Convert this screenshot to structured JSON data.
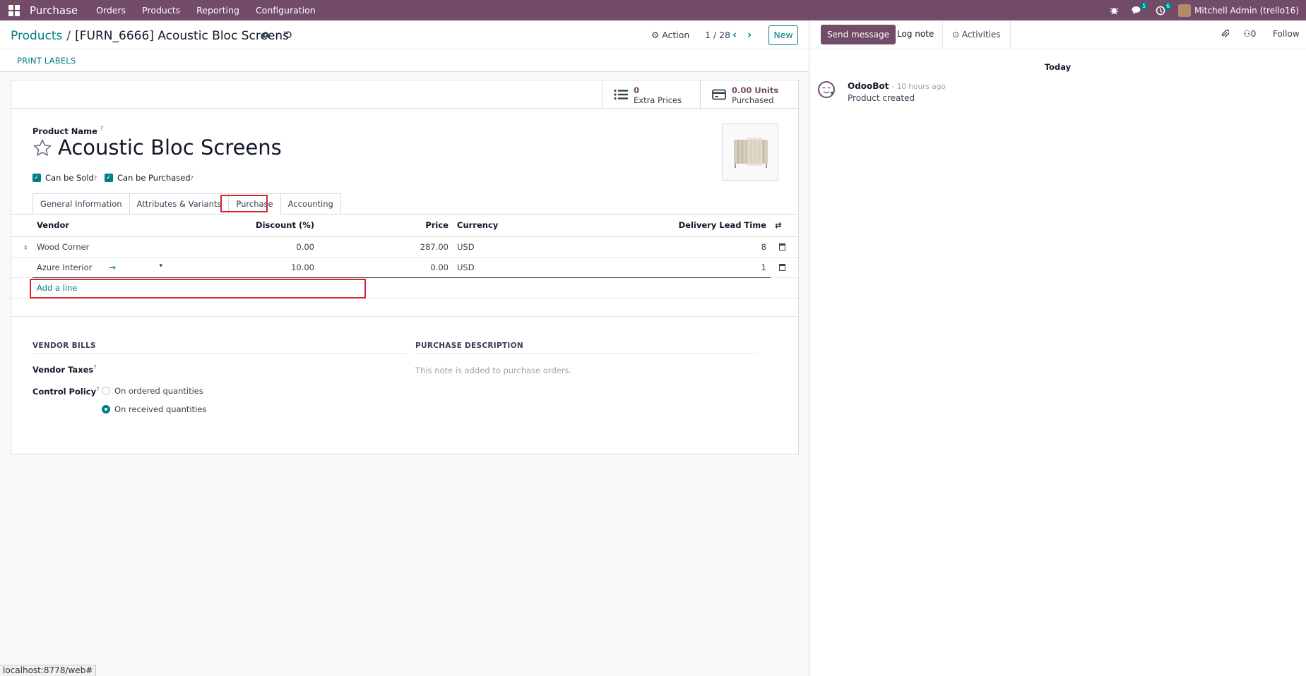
{
  "topbar": {
    "app_name": "Purchase",
    "menu": [
      "Orders",
      "Products",
      "Reporting",
      "Configuration"
    ],
    "messages_count": "5",
    "activities_count": "6",
    "user": "Mitchell Admin (trello16)"
  },
  "breadcrumb": {
    "parent": "Products",
    "separator": "/",
    "current": "[FURN_6666] Acoustic Bloc Screens"
  },
  "control": {
    "action_label": "Action",
    "pager": "1 / 28",
    "new_label": "New"
  },
  "subbar": {
    "print_labels": "PRINT LABELS"
  },
  "stats": {
    "extra_prices_value": "0",
    "extra_prices_label": "Extra Prices",
    "purchased_value": "0.00 Units",
    "purchased_label": "Purchased"
  },
  "product": {
    "name_label": "Product Name",
    "tooltip_mark": "?",
    "name": "Acoustic Bloc Screens",
    "can_be_sold": "Can be Sold",
    "can_be_purchased": "Can be Purchased"
  },
  "tabs": [
    "General Information",
    "Attributes & Variants",
    "Purchase",
    "Accounting"
  ],
  "vendor_table": {
    "headers": [
      "Vendor",
      "Discount (%)",
      "Price",
      "Currency",
      "Delivery Lead Time"
    ],
    "rows": [
      {
        "vendor": "Wood Corner",
        "discount": "0.00",
        "price": "287.00",
        "currency": "USD",
        "lead_time": "8"
      },
      {
        "vendor": "Azure Interior",
        "discount": "10.00",
        "price": "0.00",
        "currency": "USD",
        "lead_time": "1"
      }
    ],
    "add_line": "Add a line"
  },
  "vendor_bills": {
    "title": "VENDOR BILLS",
    "taxes_label": "Vendor Taxes",
    "control_policy_label": "Control Policy",
    "options": [
      "On ordered quantities",
      "On received quantities"
    ],
    "selected": "On received quantities"
  },
  "purchase_description": {
    "title": "PURCHASE DESCRIPTION",
    "placeholder": "This note is added to purchase orders."
  },
  "chatter": {
    "send_message": "Send message",
    "log_note": "Log note",
    "activities": "Activities",
    "followers_count": "0",
    "follow": "Follow",
    "date_separator": "Today",
    "messages": [
      {
        "author": "OdooBot",
        "time": "- 10 hours ago",
        "body": "Product created"
      }
    ]
  },
  "status_url": "localhost:8778/web#",
  "colors": {
    "brand": "#714b67",
    "accent": "#017e84",
    "highlight": "#d9232d"
  }
}
